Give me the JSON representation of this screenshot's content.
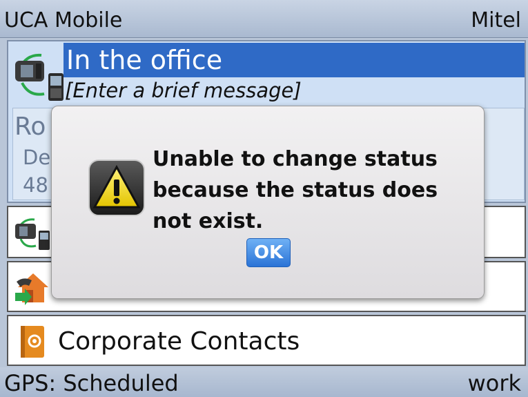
{
  "title_bar": {
    "app_name": "UCA Mobile",
    "vendor": "Mitel"
  },
  "status": {
    "selected_status": "In the office",
    "message_placeholder": "[Enter a brief message]",
    "contact_name_partial": "Ro",
    "contact_line2_partial": "De",
    "contact_line3_partial": "48"
  },
  "menu": {
    "items": [
      {
        "label": "",
        "icon": "phone-status-icon"
      },
      {
        "label": "",
        "icon": "home-call-icon"
      },
      {
        "label": "Corporate Contacts",
        "icon": "address-book-icon"
      }
    ]
  },
  "bottom_bar": {
    "gps": "GPS: Scheduled",
    "mode": "work"
  },
  "dialog": {
    "message": "Unable to change status because the status does not exist.",
    "ok_label": "OK",
    "icon": "warning-icon"
  },
  "colors": {
    "selection": "#2f6ac6",
    "title_bar": "#b9c6d8",
    "ok_button": "#2a73d6"
  }
}
